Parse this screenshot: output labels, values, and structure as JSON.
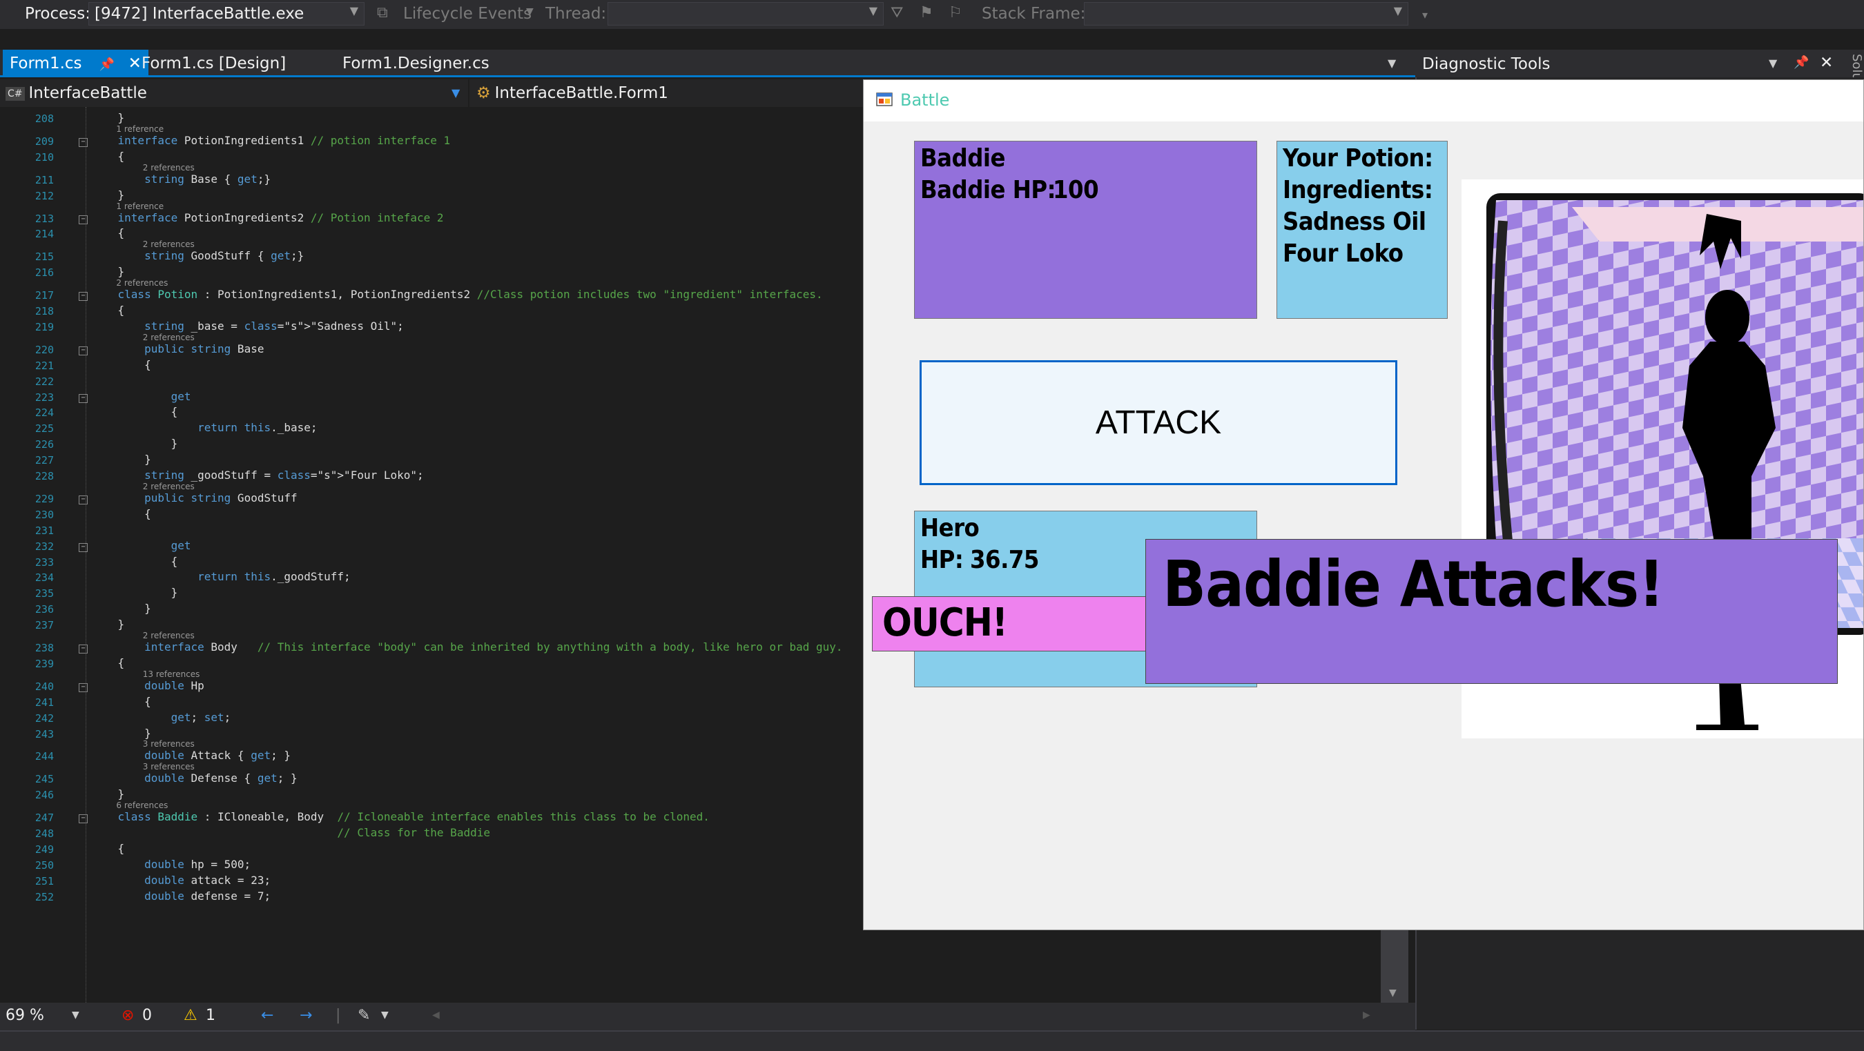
{
  "toolbar": {
    "process_label": "Process:",
    "process_value": "[9472] InterfaceBattle.exe",
    "lifecycle_label": "Lifecycle Events",
    "thread_label": "Thread:",
    "stack_frame_label": "Stack Frame:"
  },
  "tabs": [
    {
      "label": "Form1.cs",
      "active": true
    },
    {
      "label": "Form1.cs [Design]",
      "active": false
    },
    {
      "label": "Form1.Designer.cs",
      "active": false
    }
  ],
  "navbar": {
    "project": "InterfaceBattle",
    "project_badge": "C#",
    "class_path": "InterfaceBattle.Form1"
  },
  "diagnostic": {
    "title": "Diagnostic Tools",
    "side_label": "Solu"
  },
  "editor": {
    "lines": [
      {
        "n": "208",
        "code": "    }"
      },
      {
        "n": "209",
        "ref": "1 reference",
        "code": "    interface PotionIngredients1 // potion interface 1"
      },
      {
        "n": "210",
        "code": "    {"
      },
      {
        "n": "211",
        "ref": "2 references",
        "code": "        string Base { get;}"
      },
      {
        "n": "212",
        "code": "    }"
      },
      {
        "n": "213",
        "ref": "1 reference",
        "code": "    interface PotionIngredients2 // Potion inteface 2"
      },
      {
        "n": "214",
        "code": "    {"
      },
      {
        "n": "215",
        "ref": "2 references",
        "code": "        string GoodStuff { get;}"
      },
      {
        "n": "216",
        "code": "    }"
      },
      {
        "n": "217",
        "ref": "2 references",
        "code": "    class Potion : PotionIngredients1, PotionIngredients2 //Class potion includes two \"ingredient\" interfaces."
      },
      {
        "n": "218",
        "code": "    {"
      },
      {
        "n": "219",
        "code": "        string _base = \"Sadness Oil\";"
      },
      {
        "n": "220",
        "ref": "2 references",
        "code": "        public string Base"
      },
      {
        "n": "221",
        "code": "        {"
      },
      {
        "n": "222",
        "code": ""
      },
      {
        "n": "223",
        "code": "            get"
      },
      {
        "n": "224",
        "code": "            {"
      },
      {
        "n": "225",
        "code": "                return this._base;"
      },
      {
        "n": "226",
        "code": "            }"
      },
      {
        "n": "227",
        "code": "        }"
      },
      {
        "n": "228",
        "code": "        string _goodStuff = \"Four Loko\";"
      },
      {
        "n": "229",
        "ref": "2 references",
        "code": "        public string GoodStuff"
      },
      {
        "n": "230",
        "code": "        {"
      },
      {
        "n": "231",
        "code": ""
      },
      {
        "n": "232",
        "code": "            get"
      },
      {
        "n": "233",
        "code": "            {"
      },
      {
        "n": "234",
        "code": "                return this._goodStuff;"
      },
      {
        "n": "235",
        "code": "            }"
      },
      {
        "n": "236",
        "code": "        }"
      },
      {
        "n": "237",
        "code": "    }"
      },
      {
        "n": "238",
        "ref": "2 references",
        "code": "        interface Body   // This interface \"body\" can be inherited by anything with a body, like hero or bad guy."
      },
      {
        "n": "239",
        "code": "    {"
      },
      {
        "n": "240",
        "ref": "13 references",
        "code": "        double Hp"
      },
      {
        "n": "241",
        "code": "        {"
      },
      {
        "n": "242",
        "code": "            get; set;"
      },
      {
        "n": "243",
        "code": "        }"
      },
      {
        "n": "244",
        "ref": "3 references",
        "code": "        double Attack { get; }"
      },
      {
        "n": "245",
        "ref": "3 references",
        "code": "        double Defense { get; }"
      },
      {
        "n": "246",
        "code": "    }"
      },
      {
        "n": "247",
        "ref": "6 references",
        "code": "    class Baddie : ICloneable, Body  // Icloneable interface enables this class to be cloned."
      },
      {
        "n": "248",
        "code": "                                     // Class for the Baddie"
      },
      {
        "n": "249",
        "code": "    {"
      },
      {
        "n": "250",
        "code": "        double hp = 500;"
      },
      {
        "n": "251",
        "code": "        double attack = 23;"
      },
      {
        "n": "252",
        "code": "        double defense = 7;"
      }
    ]
  },
  "status": {
    "zoom": "69 %",
    "errors": "0",
    "warnings": "1"
  },
  "battle": {
    "title": "Battle",
    "baddie_name": "Baddie",
    "baddie_hp_label": "Baddie HP:",
    "baddie_hp": "100",
    "potion_title": "Your Potion:",
    "potion_ingredients_label": "Ingredients:",
    "potion_ingredient_1": "Sadness Oil",
    "potion_ingredient_2": "Four Loko",
    "attack_button": "ATTACK",
    "hero_name": "Hero",
    "hero_hp_label": "HP:",
    "hero_hp": "36.75",
    "ouch": "OUCH!",
    "baddie_attacks": "Baddie Attacks!"
  },
  "colors": {
    "accent": "#007acc",
    "baddie_panel": "#9370db",
    "potion_panel": "#87ceeb",
    "hero_panel": "#87ceeb",
    "ouch_panel": "#ee82ee"
  }
}
